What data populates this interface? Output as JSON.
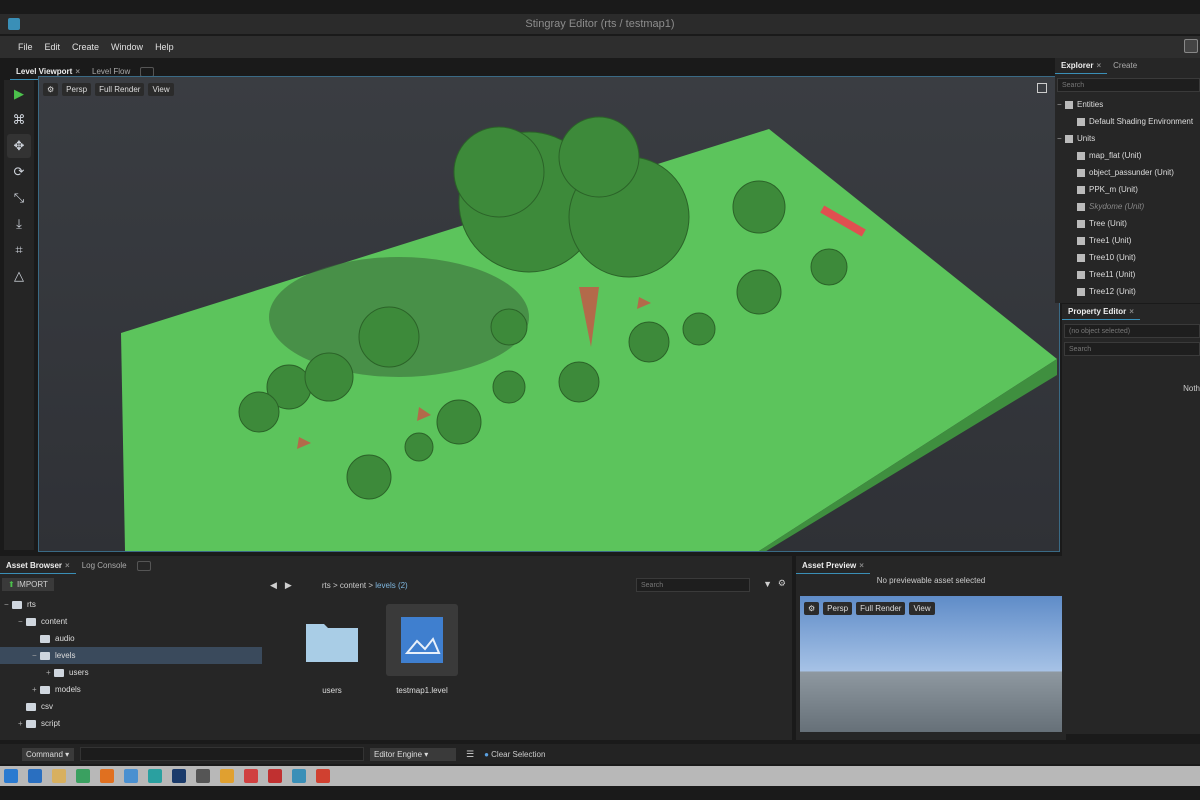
{
  "window": {
    "title": "Stingray Editor (rts / testmap1)"
  },
  "menu": [
    "File",
    "Edit",
    "Create",
    "Window",
    "Help"
  ],
  "viewport": {
    "tabs": [
      {
        "label": "Level Viewport",
        "active": true
      },
      {
        "label": "Level Flow",
        "active": false
      }
    ],
    "toolbar": {
      "persp": "Persp",
      "render": "Full Render",
      "view": "View"
    }
  },
  "explorer": {
    "tabs": [
      "Explorer",
      "Create"
    ],
    "search_placeholder": "Search",
    "entities_label": "Entities",
    "entities": [
      "Default Shading Environment"
    ],
    "units_label": "Units",
    "units": [
      {
        "label": "map_flat (Unit)",
        "dim": false
      },
      {
        "label": "object_passunder (Unit)",
        "dim": false
      },
      {
        "label": "PPK_m (Unit)",
        "dim": false
      },
      {
        "label": "Skydome (Unit)",
        "dim": true
      },
      {
        "label": "Tree (Unit)",
        "dim": false
      },
      {
        "label": "Tree1 (Unit)",
        "dim": false
      },
      {
        "label": "Tree10 (Unit)",
        "dim": false
      },
      {
        "label": "Tree11 (Unit)",
        "dim": false
      },
      {
        "label": "Tree12 (Unit)",
        "dim": false
      }
    ]
  },
  "property_editor": {
    "tab": "Property Editor",
    "selected": "(no object selected)",
    "search_placeholder": "Search",
    "empty": "Noth"
  },
  "asset_browser": {
    "tabs": [
      "Asset Browser",
      "Log Console"
    ],
    "import_label": "IMPORT",
    "tree": [
      {
        "label": "rts",
        "depth": 0,
        "caret": "−",
        "selected": false
      },
      {
        "label": "content",
        "depth": 1,
        "caret": "−",
        "selected": false
      },
      {
        "label": "audio",
        "depth": 2,
        "caret": "",
        "selected": false
      },
      {
        "label": "levels",
        "depth": 2,
        "caret": "−",
        "selected": true
      },
      {
        "label": "users",
        "depth": 3,
        "caret": "+",
        "selected": false
      },
      {
        "label": "models",
        "depth": 2,
        "caret": "+",
        "selected": false
      },
      {
        "label": "csv",
        "depth": 1,
        "caret": "",
        "selected": false
      },
      {
        "label": "script",
        "depth": 1,
        "caret": "+",
        "selected": false
      }
    ],
    "breadcrumb": {
      "root": "rts",
      "sep": ">",
      "mid": "content",
      "current": "levels (2)"
    },
    "search_placeholder": "Search",
    "assets": [
      {
        "label": "users",
        "type": "folder"
      },
      {
        "label": "testmap1.level",
        "type": "level"
      }
    ]
  },
  "asset_preview": {
    "tab": "Asset Preview",
    "message": "No previewable asset selected",
    "toolbar": {
      "persp": "Persp",
      "render": "Full Render",
      "view": "View"
    }
  },
  "statusbar": {
    "command": "Command ▾",
    "engine": "Editor Engine ▾",
    "clear": "Clear Selection"
  }
}
